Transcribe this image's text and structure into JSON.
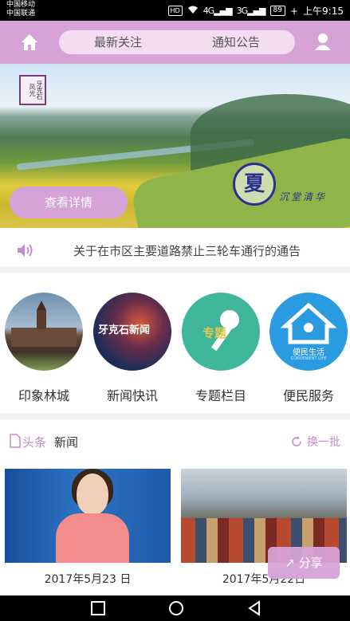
{
  "status_bar": {
    "carrier1": "中国移动",
    "carrier2": "中国联通",
    "hd": "HD",
    "signal1": "4G",
    "signal2": "3G",
    "battery": "89",
    "time": "上午9:15"
  },
  "header": {
    "tabs": [
      "最新关注",
      "通知公告"
    ]
  },
  "banner": {
    "detail_button": "查看详情",
    "logo_char": "夏",
    "logo_subtitle": "沉堂清华",
    "seal_text": "牙克石风光"
  },
  "notice": {
    "text": "关于在市区主要道路禁止三轮车通行的通告"
  },
  "categories": [
    {
      "label": "印象林城",
      "caption": ""
    },
    {
      "label": "新闻快讯",
      "caption": "牙克石新闻"
    },
    {
      "label": "专题栏目",
      "caption": "专题"
    },
    {
      "label": "便民服务",
      "caption": "便民生活",
      "caption_en": "CONVENIENT LIFE"
    }
  ],
  "news_section": {
    "tag": "头条",
    "title": "新闻",
    "refresh_label": "换一批"
  },
  "news_items": [
    {
      "date": "2017年5月23 日"
    },
    {
      "date": "2017年5月22日"
    }
  ],
  "share_button": "分享",
  "colors": {
    "accent": "#d7a3d7",
    "accent_light": "#f4ddf2",
    "accent_text": "#c58bd0"
  }
}
